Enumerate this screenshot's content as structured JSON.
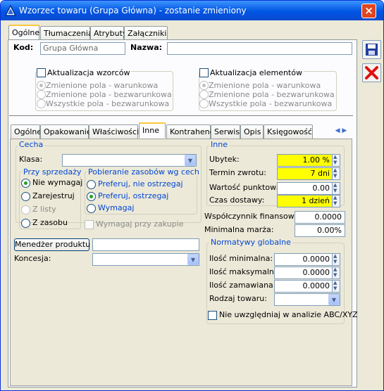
{
  "window": {
    "title": "Wzorzec towaru (Grupa Główna) - zostanie zmieniony",
    "close_glyph": "×"
  },
  "top_tabs": [
    "Ogólne",
    "Tłumaczenia",
    "Atrybuty",
    "Załączniki"
  ],
  "header": {
    "kod_label": "Kod:",
    "kod_value": "Grupa Główna",
    "nazwa_label": "Nazwa:",
    "nazwa_value": ""
  },
  "update_patterns": {
    "label": "Aktualizacja wzorców",
    "options": [
      "Zmienione pola - warunkowa",
      "Zmienione pola - bezwarunkowa",
      "Wszystkie pola - bezwarunkowa"
    ]
  },
  "update_elements": {
    "label": "Aktualizacja elementów",
    "options": [
      "Zmienione pola - warunkowa",
      "Zmienione pola - bezwarunkowa",
      "Wszystkie pola - bezwarunkowa"
    ]
  },
  "inner_tabs": [
    "Ogólne",
    "Opakowanie",
    "Właściwości",
    "Inne",
    "Kontrahenci",
    "Serwis",
    "Opis",
    "Księgowość"
  ],
  "cecha": {
    "title": "Cecha",
    "klasa_label": "Klasa:",
    "klasa_value": ""
  },
  "sale": {
    "title": "Przy sprzedaży",
    "options": [
      "Nie wymagaj",
      "Zarejestruj",
      "Z listy",
      "Z zasobu"
    ]
  },
  "resources": {
    "title": "Pobieranie zasobów wg cech",
    "options": [
      "Preferuj, nie ostrzegaj",
      "Preferuj, ostrzegaj",
      "Wymagaj"
    ],
    "purchase_label": "Wymagaj przy zakupie"
  },
  "product_manager": {
    "button": "Menedżer produktu",
    "value": ""
  },
  "koncesja": {
    "label": "Koncesja:",
    "value": ""
  },
  "inne": {
    "title": "Inne",
    "ubytek_label": "Ubytek:",
    "ubytek_value": "1.00 %",
    "termin_label": "Termin zwrotu:",
    "termin_value": "7 dni",
    "wartosc_label": "Wartość punktowa:",
    "wartosc_value": "0.00",
    "czas_label": "Czas dostawy:",
    "czas_value": "1 dzień",
    "wspolczynnik_label": "Współczynnik finansowy:",
    "wspolczynnik_value": "0.0000",
    "marza_label": "Minimalna marża:",
    "marza_value": "0.00%"
  },
  "normatywy": {
    "title": "Normatywy globalne",
    "min_label": "Ilość minimalna:",
    "min_value": "0.0000",
    "max_label": "Ilość maksymalna:",
    "max_value": "0.0000",
    "zam_label": "Ilość zamawiana:",
    "zam_value": "0.0000",
    "rodzaj_label": "Rodzaj towaru:",
    "rodzaj_value": "",
    "abc_label": "Nie uwzględniaj w analizie ABC/XYZ"
  },
  "colors": {
    "accent": "#0046d5",
    "highlight": "#ffff00",
    "titlebar": "#0054e3"
  }
}
